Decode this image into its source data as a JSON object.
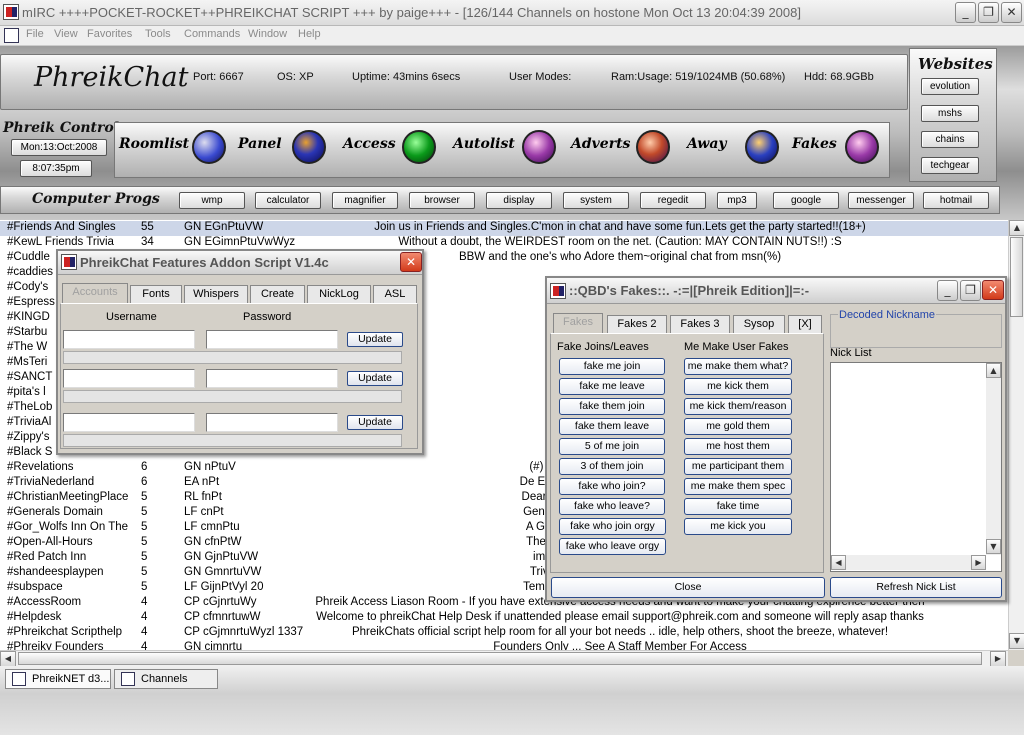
{
  "window": {
    "title": "mIRC ++++POCKET-ROCKET++PHREIKCHAT SCRIPT +++ by paige+++ - [126/144 Channels on hostone Mon Oct 13 20:04:39 2008]",
    "min": "_",
    "max": "❐",
    "close": "✕"
  },
  "menu": [
    "File",
    "View",
    "Favorites",
    "Tools",
    "Commands",
    "Window",
    "Help"
  ],
  "header": {
    "logo": "PhreikChat",
    "port": "Port: 6667",
    "os": "OS: XP",
    "uptime": "Uptime: 43mins 6secs",
    "usermodes": "User Modes:",
    "ram": "Ram:Usage: 519/1024MB (50.68%)",
    "hdd": "Hdd:  68.9GBb",
    "controls_title": "Phreik Controls",
    "date": "Mon:13:Oct:2008",
    "time": "8:07:35pm",
    "controls": [
      "Roomlist",
      "Panel",
      "Access",
      "Autolist",
      "Adverts",
      "Away",
      "Fakes"
    ],
    "websites_title": "Websites",
    "websites": [
      "evolution",
      "mshs",
      "chains",
      "techgear"
    ],
    "progs_title": "Computer Progs",
    "progs": [
      "wmp",
      "calculator",
      "magnifier",
      "browser",
      "display",
      "system",
      "regedit",
      "mp3",
      "google",
      "messenger",
      "hotmail"
    ]
  },
  "channels": [
    {
      "name": "#Friends And Singles",
      "users": "55",
      "modes": "GN EGnPtuVW",
      "topic": "Join us in Friends and Singles.C'mon in chat and have some fun.Lets get the party started!!(18+)"
    },
    {
      "name": "#KewL Friends Trivia",
      "users": "34",
      "modes": "GN EGimnPtuVwWyz",
      "topic": "Without a doubt, the WEIRDEST room on the net. (Caution: MAY CONTAIN NUTS!!) :S"
    },
    {
      "name": "#Cuddle",
      "users": "",
      "modes": "",
      "topic": "BBW and the one's who Adore them~original chat from msn(%)"
    },
    {
      "name": "#caddies",
      "users": "",
      "modes": "",
      "topic": ""
    },
    {
      "name": "#Cody's",
      "users": "",
      "modes": "",
      "topic": "yone,Trivia & Chat,.W"
    },
    {
      "name": "#Espress",
      "users": "",
      "modes": "",
      "topic": "to Espressobar ... sit b"
    },
    {
      "name": "#KINGD",
      "users": "",
      "modes": "",
      "topic": ""
    },
    {
      "name": "#Starbu",
      "users": "",
      "modes": "",
      "topic": "COME!!! Sit back, relax"
    },
    {
      "name": "#The W",
      "users": "",
      "modes": "",
      "topic": "m Friendly Chat Room"
    },
    {
      "name": "#MsTeri",
      "users": "",
      "modes": "",
      "topic": "ll bi str8 lez cd Dom/m"
    },
    {
      "name": "#SANCT",
      "users": "",
      "modes": "",
      "topic": "fun pararnormal to all"
    },
    {
      "name": "#pita's l",
      "users": "",
      "modes": "",
      "topic": "e eerie erotica contes"
    },
    {
      "name": "#TheLob",
      "users": "",
      "modes": "",
      "topic": "TheLobby is an all ag"
    },
    {
      "name": "#TriviaAl",
      "users": "",
      "modes": "",
      "topic": "k games, with the frie"
    },
    {
      "name": "#Zippy's",
      "users": "",
      "modes": "",
      "topic": "Zippy's Trivia Sorry 18-"
    },
    {
      "name": "#Black S",
      "users": "",
      "modes": "",
      "topic": "(©¤º°ª¹-ª– ß@®ß®™"
    },
    {
      "name": "#Revelations",
      "users": "6",
      "modes": "GN nPtuV",
      "topic": "(#) 24/7 TRIVIA (S) Great ppl (h) Gr"
    },
    {
      "name": "#TriviaNederland",
      "users": "6",
      "modes": "EA nPt",
      "topic": "De Enige Echte Trivia Room van Neder"
    },
    {
      "name": "#ChristianMeetingPlace",
      "users": "5",
      "modes": "RL fnPt",
      "topic": "Dear friends, although I was very eage"
    },
    {
      "name": "#Generals Domain",
      "users": "5",
      "modes": "LF cnPt",
      "topic": "General welcomes Y/you ~ Respect &"
    },
    {
      "name": "#Gor_Wolfs Inn On The",
      "users": "5",
      "modes": "LF cmnPtu",
      "topic": "A Gorean Working Inn. Safe Zoned. I"
    },
    {
      "name": "#Open-All-Hours",
      "users": "5",
      "modes": "GN cfnPtW",
      "topic": "The Closest Trivia to Arena :P Pop in"
    },
    {
      "name": "#Red Patch Inn",
      "users": "5",
      "modes": "GN GjnPtuVW",
      "topic": "im gonna change my name to butt"
    },
    {
      "name": "#shandeesplaypen",
      "users": "5",
      "modes": "GN GmnrtuVW",
      "topic": "Trivia, WordFrenzy Slots & Friendly"
    },
    {
      "name": "#subspace",
      "users": "5",
      "modes": "LF GijnPtVyl 20",
      "topic": "Temporarily closed for medical reason"
    },
    {
      "name": "#AccessRoom",
      "users": "4",
      "modes": "CP cGjnrtuWy",
      "topic": "Phreik Access Liason Room - If you have extensive access needs and want to make your chatting expirence better then"
    },
    {
      "name": "#Helpdesk",
      "users": "4",
      "modes": "CP cfmnrtuwW",
      "topic": "Welcome to phreikChat Help Desk if unattended please email support@phreik.com and someone will reply asap thanks"
    },
    {
      "name": "#Phreikchat Scripthelp",
      "users": "4",
      "modes": "CP cGjmnrtuWyzl 1337",
      "topic": "PhreikChats official script help room for all your bot needs .. idle, help others, shoot the breeze, whatever!"
    },
    {
      "name": "#Phreiky Founders",
      "users": "4",
      "modes": "GN cjmnrtu",
      "topic": "Founders Only ... See A Staff Member For Access"
    }
  ],
  "taskbar": [
    "PhreikNET d3...",
    "Channels"
  ],
  "addon": {
    "title": "PhreikChat Features Addon Script V1.4c",
    "tabs": [
      "Accounts",
      "Fonts",
      "Whispers",
      "Create",
      "NickLog",
      "ASL"
    ],
    "username_label": "Username",
    "password_label": "Password",
    "update_label": "Update",
    "close": "✕"
  },
  "fakes": {
    "title": "::QBD's Fakes::. -:=|[Phreik Edition]|=:-",
    "tabs": [
      "Fakes",
      "Fakes 2",
      "Fakes 3",
      "Sysop",
      "[X]"
    ],
    "joins_header": "Fake Joins/Leaves",
    "joins": [
      "fake me join",
      "fake me leave",
      "fake them join",
      "fake them leave",
      "5 of me join",
      "3 of them join",
      "fake who join?",
      "fake who leave?",
      "fake who join orgy",
      "fake who leave orgy"
    ],
    "users_header": "Me Make User Fakes",
    "users": [
      "me make them what?",
      "me kick them",
      "me kick them/reason",
      "me gold them",
      "me host them",
      "me participant them",
      "me make them spec",
      "fake time",
      "me kick you"
    ],
    "decoded_label": "Decoded Nickname",
    "nicklist_label": "Nick List",
    "close_label": "Close",
    "refresh_label": "Refresh Nick List",
    "min": "_",
    "max": "❐",
    "close": "✕"
  }
}
